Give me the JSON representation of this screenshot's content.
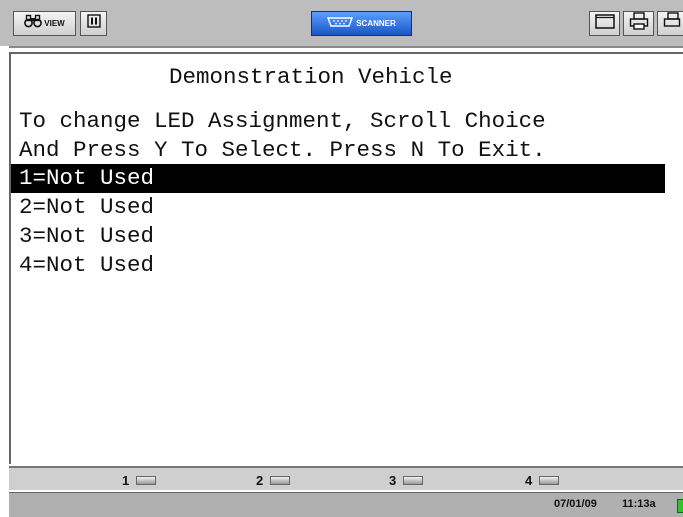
{
  "toolbar": {
    "view_label": "VIEW",
    "scanner_label": "SCANNER",
    "icons": [
      "binoculars-icon",
      "pause-icon",
      "connector-icon",
      "window-icon",
      "print-icon",
      "more-icon"
    ]
  },
  "screen": {
    "title": "Demonstration Vehicle",
    "instruction_line1": "To change LED Assignment, Scroll Choice",
    "instruction_line2": "And Press Y To Select. Press N To Exit.",
    "items": [
      {
        "label": "1=Not Used",
        "selected": true
      },
      {
        "label": "2=Not Used",
        "selected": false
      },
      {
        "label": "3=Not Used",
        "selected": false
      },
      {
        "label": "4=Not Used",
        "selected": false
      }
    ]
  },
  "leds": [
    {
      "label": "1"
    },
    {
      "label": "2"
    },
    {
      "label": "3"
    },
    {
      "label": "4"
    }
  ],
  "status": {
    "date": "07/01/09",
    "time": "11:13a"
  },
  "colors": {
    "toolbar_bg": "#bdbdbd",
    "scanner_button": "#1a55c8",
    "selection_bg": "#000000",
    "indicator_green": "#2ec42e"
  }
}
